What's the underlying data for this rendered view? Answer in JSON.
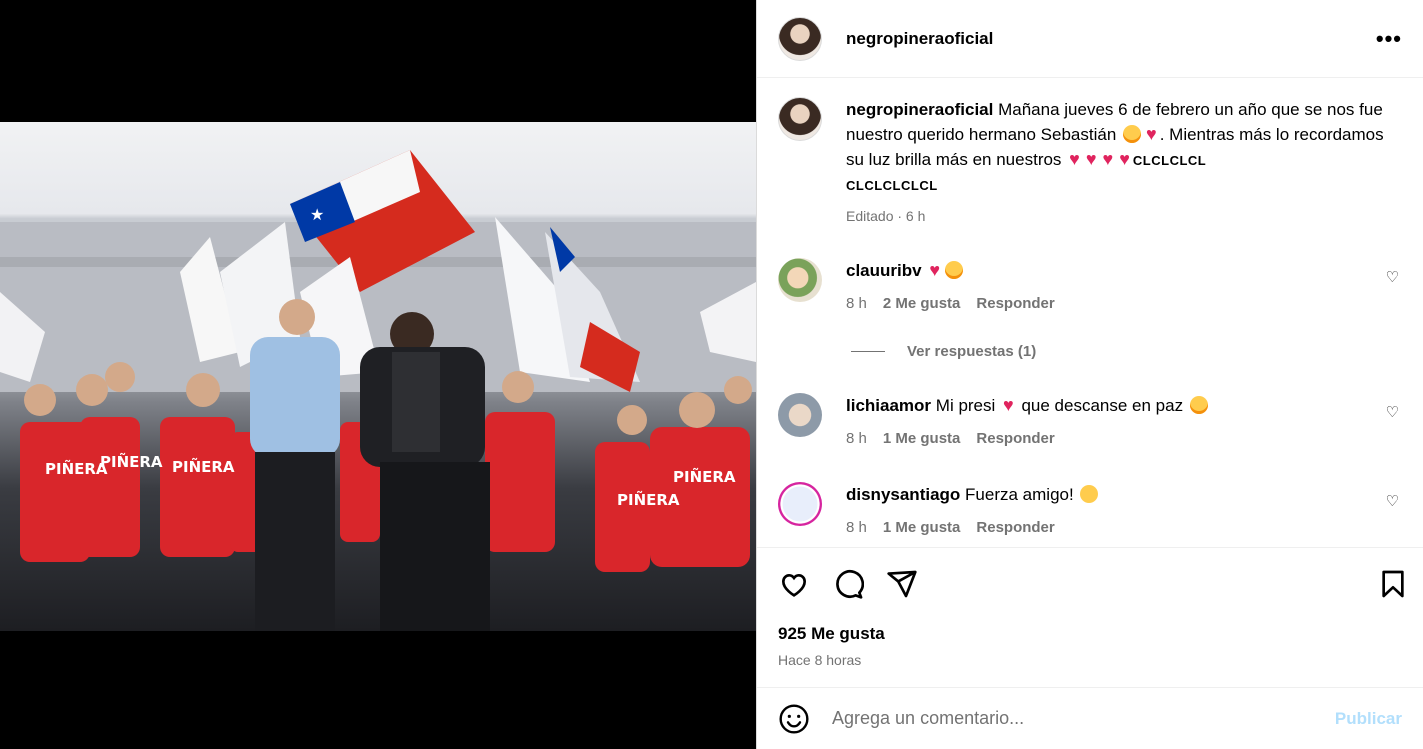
{
  "post": {
    "username": "negropineraoficial",
    "more_label": "•••"
  },
  "caption": {
    "username": "negropineraoficial",
    "text_1": "Mañana jueves 6 de febrero un año que se nos fue nuestro querido hermano Sebastián",
    "text_2": ". Mientras más lo recordamos su luz brilla más en nuestros",
    "tail_1": "CLCLCLCL",
    "tail_2": "CLCLCLCLCL",
    "edited": "Editado · 6 h"
  },
  "comments": [
    {
      "username": "clauuribv",
      "text": "",
      "time": "8 h",
      "likes": "2 Me gusta",
      "reply": "Responder"
    },
    {
      "username": "lichiaamor",
      "text_a": "Mi presi",
      "text_b": "que descanse en paz",
      "time": "8 h",
      "likes": "1 Me gusta",
      "reply": "Responder"
    },
    {
      "username": "disnysantiago",
      "text": "Fuerza amigo!",
      "time": "8 h",
      "likes": "1 Me gusta",
      "reply": "Responder"
    }
  ],
  "replies_toggle": "Ver respuestas (1)",
  "likes_count": "925 Me gusta",
  "posted_time": "Hace 8 horas",
  "comment_input": {
    "placeholder": "Agrega un comentario...",
    "publish": "Publicar"
  },
  "icons": {
    "like": "heart-outline-icon",
    "comment": "speech-bubble-icon",
    "share": "paper-plane-icon",
    "save": "bookmark-icon",
    "emoji": "smiley-icon",
    "more": "more-dots-icon"
  },
  "colors": {
    "heart_red": "#e0245e",
    "muted": "#737373",
    "publish_disabled": "#b2dffc",
    "flag_red": "#d52b1e",
    "flag_blue": "#0039a6",
    "vest_red": "#d9262b"
  }
}
